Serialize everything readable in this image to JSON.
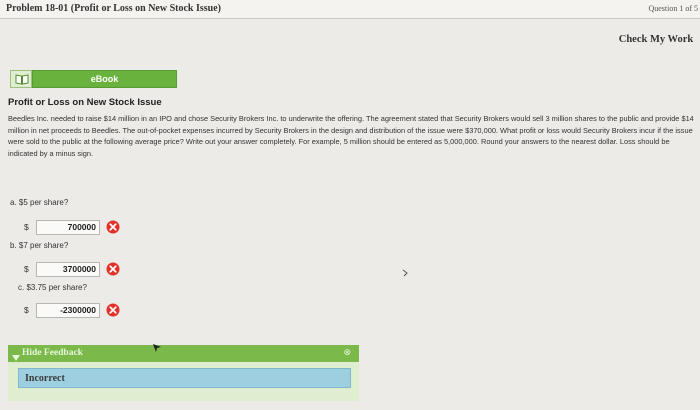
{
  "header": {
    "title": "Problem 18-01 (Profit or Loss on New Stock Issue)",
    "question_nav": "Question 1 of 5"
  },
  "check_work_label": "Check My Work",
  "ebook_label": "eBook",
  "problem": {
    "heading": "Profit or Loss on New Stock Issue",
    "text": "Beedles Inc. needed to raise $14 million in an IPO and chose Security Brokers Inc. to underwrite the offering. The agreement stated that Security Brokers would sell 3 million shares to the public and provide $14 million in net proceeds to Beedles. The out-of-pocket expenses incurred by Security Brokers in the design and distribution of the issue were $370,000. What profit or loss would Security Brokers incur if the issue were sold to the public at the following average price? Write out your answer completely. For example, 5 million should be entered as 5,000,000. Round your answers to the nearest dollar. Loss should be indicated by a minus sign."
  },
  "questions": [
    {
      "label": "a. $5 per share?",
      "currency": "$",
      "value": "700000",
      "status": "incorrect"
    },
    {
      "label": "b. $7 per share?",
      "currency": "$",
      "value": "3700000",
      "status": "incorrect"
    },
    {
      "label": "c. $3.75 per share?",
      "currency": "$",
      "value": "-2300000",
      "status": "incorrect"
    }
  ],
  "feedback": {
    "toggle_label": "Hide Feedback",
    "close_symbol": "⊗",
    "message": "Incorrect"
  },
  "colors": {
    "green": "#6ab23e",
    "error_red": "#e0322a",
    "feedback_blue": "#9dcfe0"
  }
}
